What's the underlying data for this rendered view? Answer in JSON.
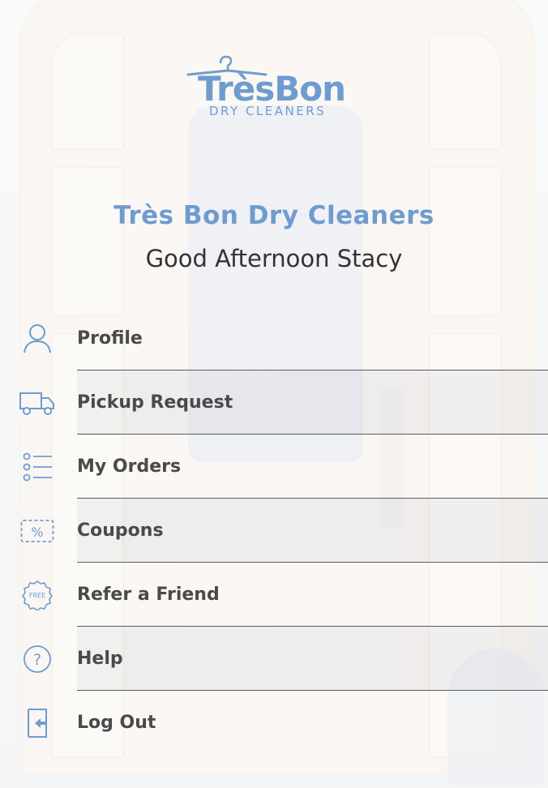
{
  "brand": {
    "logo_word": "TrèsBon",
    "logo_sub": "DRY CLEANERS",
    "app_title": "Très Bon Dry Cleaners",
    "greeting": "Good Afternoon Stacy",
    "accent_color": "#6f9ccf"
  },
  "menu": {
    "items": [
      {
        "label": "Profile",
        "icon": "person-icon"
      },
      {
        "label": "Pickup Request",
        "icon": "delivery-truck-icon"
      },
      {
        "label": "My Orders",
        "icon": "list-icon"
      },
      {
        "label": "Coupons",
        "icon": "percent-coupon-icon"
      },
      {
        "label": "Refer a Friend",
        "icon": "free-badge-icon",
        "icon_text": "FREE"
      },
      {
        "label": "Help",
        "icon": "help-question-icon"
      },
      {
        "label": "Log Out",
        "icon": "logout-icon"
      }
    ]
  }
}
